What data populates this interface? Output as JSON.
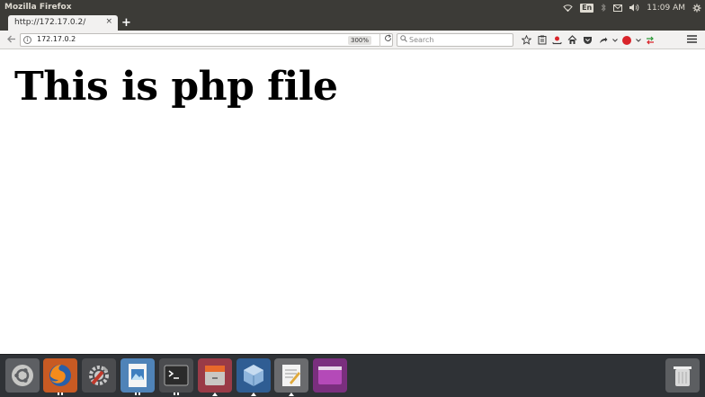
{
  "top_panel": {
    "app_title": "Mozilla Firefox",
    "keyboard_layout": "En",
    "clock": "11:09 AM"
  },
  "tabs": [
    {
      "label": "http://172.17.0.2/",
      "close": "×"
    }
  ],
  "new_tab_label": "+",
  "navigation": {
    "url": "172.17.0.2",
    "zoom": "300%",
    "search_placeholder": "Search"
  },
  "page": {
    "heading": "This is php file"
  },
  "launcher": {
    "items": [
      "ubuntu-dash-icon",
      "firefox-icon",
      "system-settings-icon",
      "image-viewer-icon",
      "terminal-icon",
      "file-cabinet-icon",
      "virtualbox-icon",
      "text-editor-icon",
      "workspace-switcher-icon",
      "trash-icon"
    ]
  },
  "colors": {
    "panel_bg": "#3c3b37",
    "toolbar_bg": "#f2f1f0",
    "launcher_bg": "#2f3236",
    "firefox_orange": "#e66000",
    "abp_red": "#d9242a"
  }
}
